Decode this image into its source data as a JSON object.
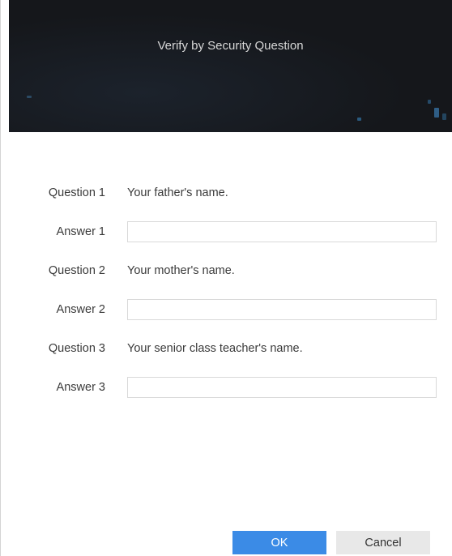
{
  "dialog": {
    "title": "Verify by Security Question"
  },
  "questions": [
    {
      "question_label": "Question 1",
      "question_text": "Your father's name.",
      "answer_label": "Answer 1",
      "answer_value": ""
    },
    {
      "question_label": "Question 2",
      "question_text": "Your mother's name.",
      "answer_label": "Answer 2",
      "answer_value": ""
    },
    {
      "question_label": "Question 3",
      "question_text": "Your senior class teacher's name.",
      "answer_label": "Answer 3",
      "answer_value": ""
    }
  ],
  "buttons": {
    "ok_label": "OK",
    "cancel_label": "Cancel"
  },
  "colors": {
    "header_bg": "#15171b",
    "ok_bg": "#3b8be6",
    "cancel_bg": "#e8e8e8"
  }
}
